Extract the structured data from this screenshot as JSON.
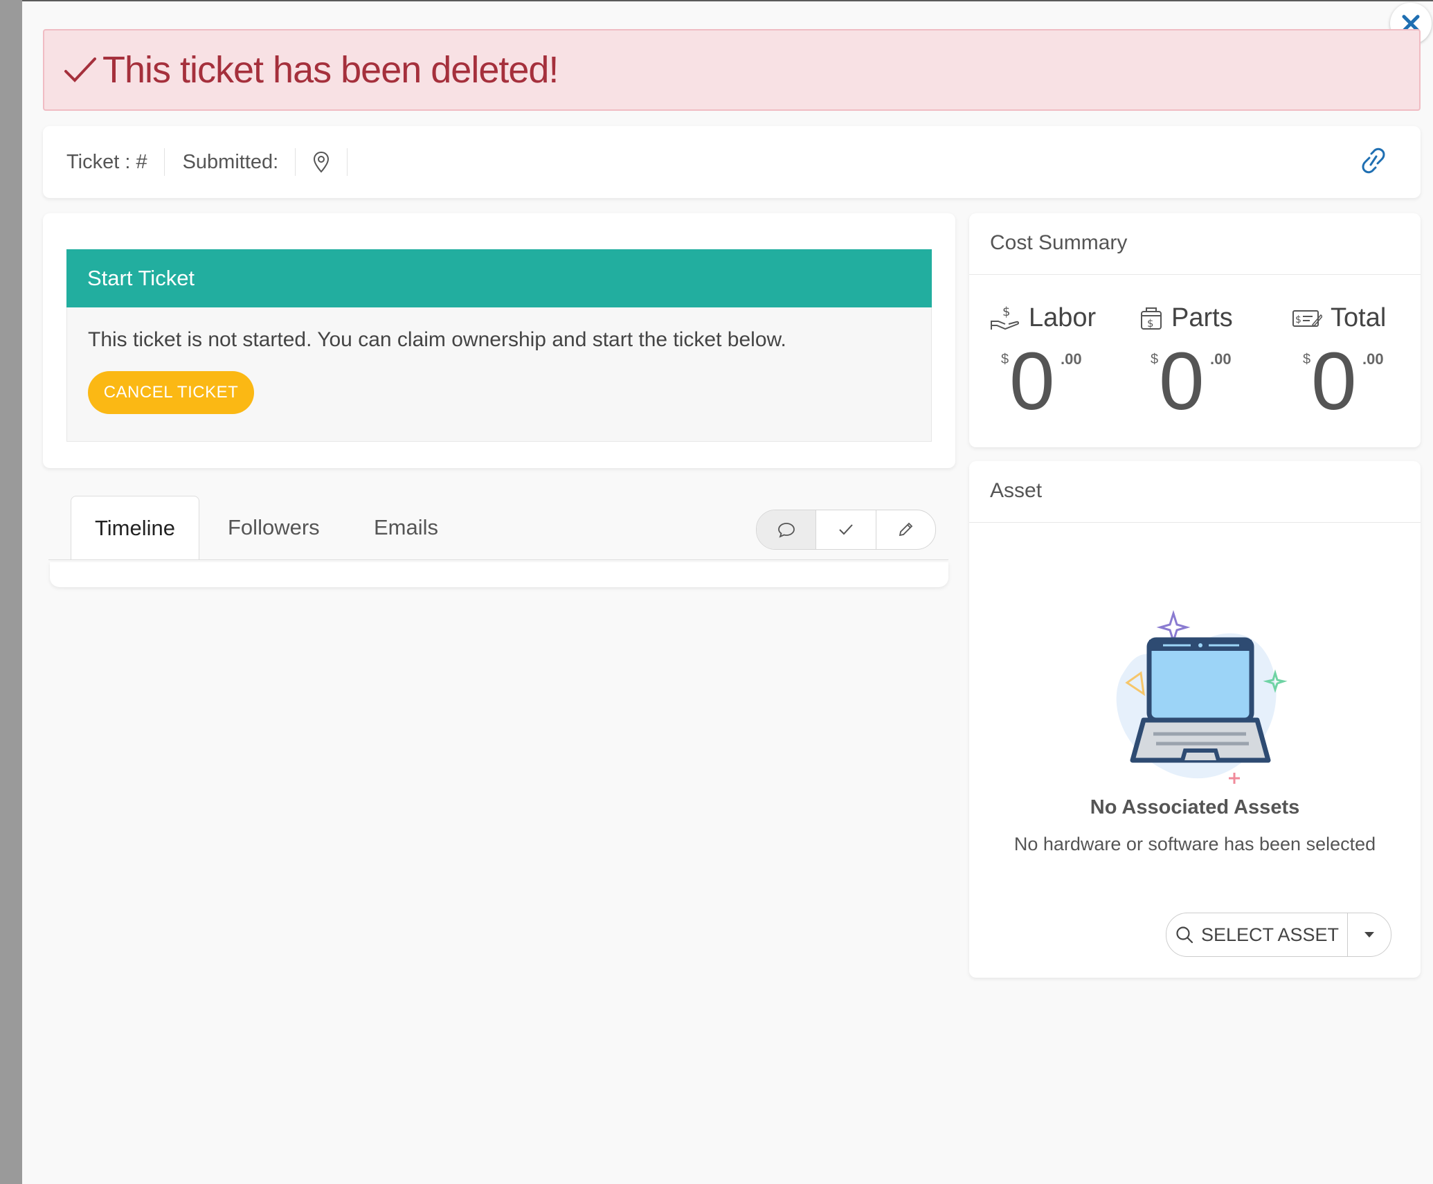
{
  "alert": {
    "message": "This ticket has been deleted!"
  },
  "ticket_bar": {
    "ticket_label": "Ticket : #",
    "submitted_label": "Submitted:"
  },
  "start_ticket": {
    "title": "Start Ticket",
    "message": "This ticket is not started. You can claim ownership and start the ticket below.",
    "cancel_label": "CANCEL TICKET"
  },
  "cost_summary": {
    "title": "Cost Summary",
    "currency": "$",
    "items": [
      {
        "label": "Labor",
        "dollars": "0",
        "cents": ".00",
        "icon": "hand-dollar-icon"
      },
      {
        "label": "Parts",
        "dollars": "0",
        "cents": ".00",
        "icon": "box-dollar-icon"
      },
      {
        "label": "Total",
        "dollars": "0",
        "cents": ".00",
        "icon": "cheque-icon"
      }
    ]
  },
  "tabs": [
    {
      "label": "Timeline",
      "active": true
    },
    {
      "label": "Followers",
      "active": false
    },
    {
      "label": "Emails",
      "active": false
    }
  ],
  "asset": {
    "title": "Asset",
    "empty_title": "No Associated Assets",
    "empty_message": "No hardware or software has been selected",
    "select_label": "SELECT ASSET"
  },
  "colors": {
    "alert_bg": "#f8e1e4",
    "alert_text": "#a5303c",
    "teal": "#22ae9f",
    "yellow": "#fbb814",
    "link_blue": "#1f6fb2"
  }
}
